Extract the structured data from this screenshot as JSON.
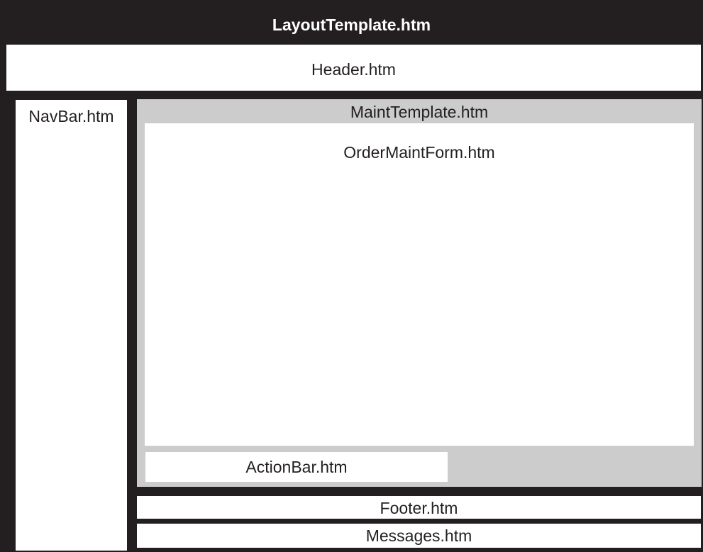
{
  "layout": {
    "title": "LayoutTemplate.htm",
    "header": "Header.htm",
    "navbar": "NavBar.htm",
    "maint_template": {
      "label": "MaintTemplate.htm",
      "form": "OrderMaintForm.htm",
      "action_bar": "ActionBar.htm"
    },
    "footer": "Footer.htm",
    "messages": "Messages.htm"
  },
  "colors": {
    "frame": "#231f20",
    "panel": "#ffffff",
    "maint_background": "#cccccc"
  }
}
